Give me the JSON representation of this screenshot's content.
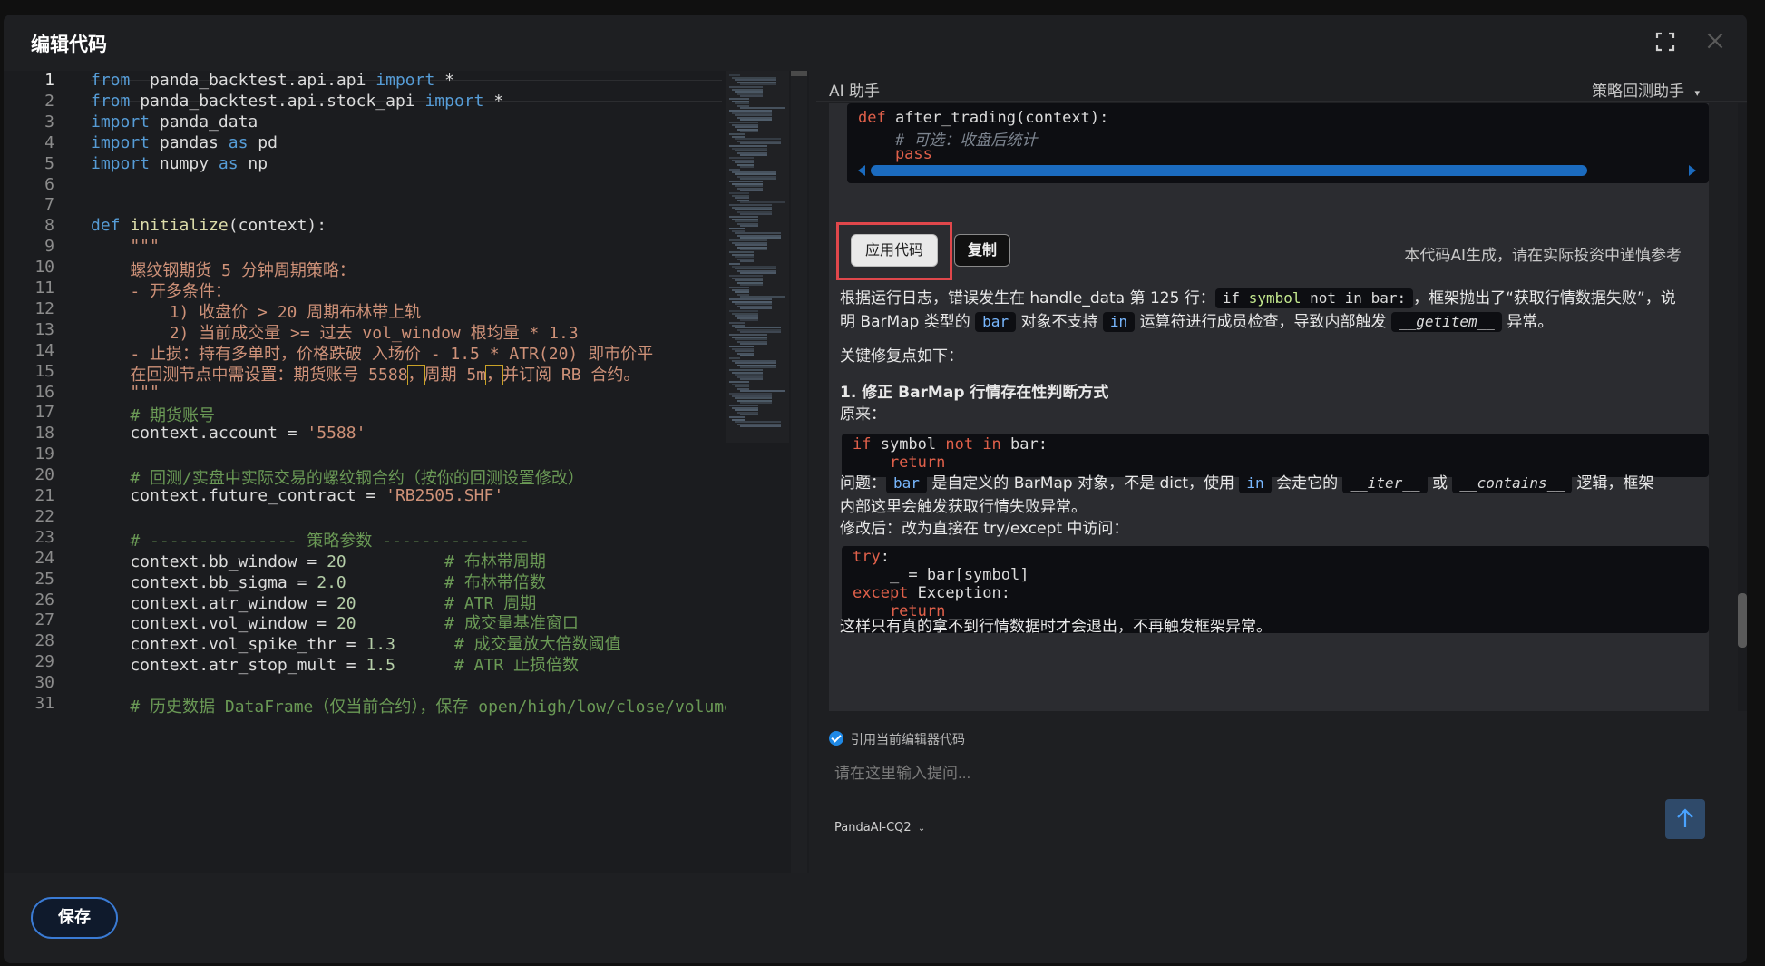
{
  "dialog": {
    "title": "编辑代码"
  },
  "editor": {
    "line_numbers": [
      "1",
      "2",
      "3",
      "4",
      "5",
      "6",
      "7",
      "8",
      "9",
      "10",
      "11",
      "12",
      "13",
      "14",
      "15",
      "16",
      "17",
      "18",
      "19",
      "20",
      "21",
      "22",
      "23",
      "24",
      "25",
      "26",
      "27",
      "28",
      "29",
      "30",
      "31"
    ],
    "active_line": 1,
    "lines": [
      [
        [
          "kw",
          "from"
        ],
        [
          "",
          "  panda_backtest.api.api "
        ],
        [
          "kw",
          "import"
        ],
        [
          "",
          " *"
        ]
      ],
      [
        [
          "kw",
          "from"
        ],
        [
          "",
          " panda_backtest.api.stock_api "
        ],
        [
          "kw",
          "import"
        ],
        [
          "",
          " *"
        ]
      ],
      [
        [
          "kw",
          "import"
        ],
        [
          "",
          " panda_data"
        ]
      ],
      [
        [
          "kw",
          "import"
        ],
        [
          "",
          " pandas "
        ],
        [
          "kw",
          "as"
        ],
        [
          "",
          " pd"
        ]
      ],
      [
        [
          "kw",
          "import"
        ],
        [
          "",
          " numpy "
        ],
        [
          "kw",
          "as"
        ],
        [
          "",
          " np"
        ]
      ],
      [],
      [],
      [
        [
          "kw",
          "def"
        ],
        [
          "",
          " "
        ],
        [
          "fn",
          "initialize"
        ],
        [
          "",
          "(context):"
        ]
      ],
      [
        [
          "doc",
          "    \"\"\""
        ]
      ],
      [
        [
          "doc",
          "    螺纹钢期货 5 分钟周期策略："
        ]
      ],
      [
        [
          "doc",
          "    - 开多条件："
        ]
      ],
      [
        [
          "doc",
          "        1) 收盘价 > 20 周期布林带上轨"
        ]
      ],
      [
        [
          "doc",
          "        2) 当前成交量 >= 过去 vol_window 根均量 * 1.3"
        ]
      ],
      [
        [
          "doc",
          "    - 止损：持有多单时，价格跌破 入场价 - 1.5 * ATR(20) 即市价平"
        ]
      ],
      [
        [
          "doc",
          "    在回测节点中需设置：期货账号 5588"
        ],
        [
          "doc-hl",
          "，"
        ],
        [
          "doc",
          "周期 5m"
        ],
        [
          "doc-hl",
          "，"
        ],
        [
          "doc",
          "并订阅 RB 合约。"
        ]
      ],
      [
        [
          "doc",
          "    \"\"\""
        ]
      ],
      [
        [
          "cmt",
          "    # 期货账号"
        ]
      ],
      [
        [
          "",
          "    context.account = "
        ],
        [
          "str",
          "'5588'"
        ]
      ],
      [],
      [
        [
          "cmt",
          "    # 回测/实盘中实际交易的螺纹钢合约（按你的回测设置修改）"
        ]
      ],
      [
        [
          "",
          "    context.future_contract = "
        ],
        [
          "str",
          "'RB2505.SHF'"
        ]
      ],
      [],
      [
        [
          "cmt",
          "    # --------------- 策略参数 ---------------"
        ]
      ],
      [
        [
          "",
          "    context.bb_window = "
        ],
        [
          "num",
          "20"
        ],
        [
          "",
          "          "
        ],
        [
          "cmt",
          "# 布林带周期"
        ]
      ],
      [
        [
          "",
          "    context.bb_sigma = "
        ],
        [
          "num",
          "2.0"
        ],
        [
          "",
          "          "
        ],
        [
          "cmt",
          "# 布林带倍数"
        ]
      ],
      [
        [
          "",
          "    context.atr_window = "
        ],
        [
          "num",
          "20"
        ],
        [
          "",
          "         "
        ],
        [
          "cmt",
          "# ATR 周期"
        ]
      ],
      [
        [
          "",
          "    context.vol_window = "
        ],
        [
          "num",
          "20"
        ],
        [
          "",
          "         "
        ],
        [
          "cmt",
          "# 成交量基准窗口"
        ]
      ],
      [
        [
          "",
          "    context.vol_spike_thr = "
        ],
        [
          "num",
          "1.3"
        ],
        [
          "",
          "      "
        ],
        [
          "cmt",
          "# 成交量放大倍数阈值"
        ]
      ],
      [
        [
          "",
          "    context.atr_stop_mult = "
        ],
        [
          "num",
          "1.5"
        ],
        [
          "",
          "      "
        ],
        [
          "cmt",
          "# ATR 止损倍数"
        ]
      ],
      [],
      [
        [
          "cmt",
          "    # 历史数据 DataFrame（仅当前合约），保存 open/high/low/close/volume"
        ]
      ]
    ]
  },
  "ai": {
    "title": "AI 助手",
    "mode": "策略回测助手",
    "top_code": [
      [
        [
          "red",
          "def"
        ],
        [
          "",
          " after_trading(context):"
        ]
      ],
      [
        [
          "italic-cmt",
          "    # 可选：收盘后统计"
        ]
      ],
      [
        [
          "red",
          "    pass"
        ]
      ]
    ],
    "apply_label": "应用代码",
    "copy_label": "复制",
    "note": "本代码AI生成，请在实际投资中谨慎参考",
    "para1_a": "根据运行日志，错误发生在 handle_data 第 125 行：",
    "para1_code_if": "if",
    "para1_code_symbol": "symbol",
    "para1_code_rest": "not in bar:",
    "para1_b": "，框架抛出了“获取行情数据失败”，说",
    "para1_c": "明 BarMap 类型的",
    "para1_bar": "bar",
    "para1_d": "对象不支持",
    "para1_in": "in",
    "para1_e": "运算符进行成员检查，导致内部触发",
    "para1_getitem": "__getitem__",
    "para1_f": "异常。",
    "key_points": "关键修复点如下：",
    "section1": "1. 修正 BarMap 行情存在性判断方式",
    "original": "原来：",
    "code_orig": [
      [
        [
          "red",
          "if"
        ],
        [
          "",
          " symbol "
        ],
        [
          "red",
          "not in"
        ],
        [
          "",
          " bar:"
        ]
      ],
      [
        [
          "red",
          "    return"
        ]
      ]
    ],
    "problem_a": "问题：",
    "problem_bar": "bar",
    "problem_b": "是自定义的 BarMap 对象，不是 dict，使用",
    "problem_in": "in",
    "problem_c": "会走它的",
    "problem_iter": "__iter__",
    "problem_d": "或",
    "problem_contains": "__contains__",
    "problem_e": "逻辑，框架",
    "problem_f": "内部这里会触发获取行情失败异常。",
    "after_fix": "修改后：改为直接在 try/except 中访问：",
    "code_fix": [
      [
        [
          "red",
          "try"
        ],
        [
          "",
          ":"
        ]
      ],
      [
        [
          "",
          "    _ = bar[symbol]"
        ]
      ],
      [
        [
          "red",
          "except"
        ],
        [
          "",
          " Exception:"
        ]
      ],
      [
        [
          "red",
          "    return"
        ]
      ]
    ],
    "conclusion": "这样只有真的拿不到行情数据时才会退出，不再触发框架异常。",
    "ref_label": "引用当前编辑器代码",
    "input_placeholder": "请在这里输入提问...",
    "model": "PandaAI-CQ2"
  },
  "footer": {
    "save_label": "保存"
  },
  "colors": {
    "accent": "#3a7bd5",
    "highlight_border": "#e0474b",
    "keyword": "#569cd6",
    "string": "#ce9178",
    "comment": "#6a9955"
  }
}
